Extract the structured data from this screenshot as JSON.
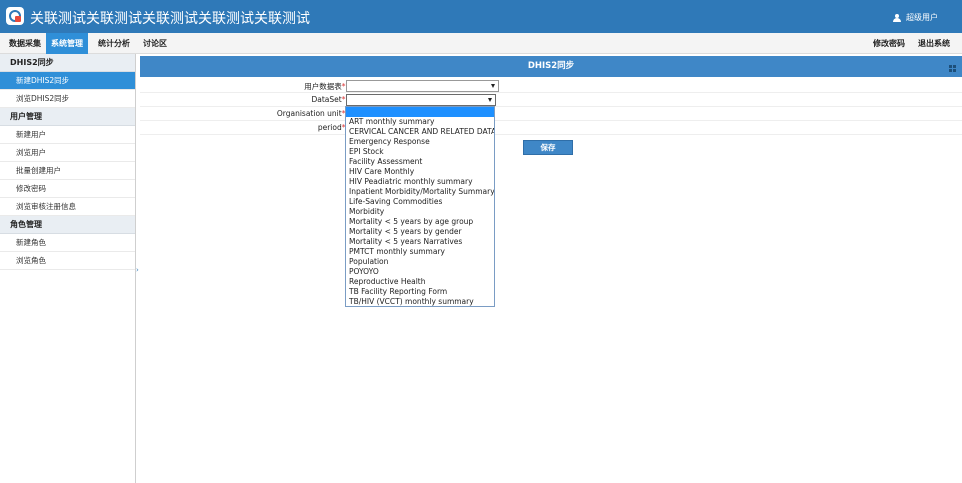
{
  "header": {
    "title": "关联测试关联测试关联测试关联测试关联测试",
    "user": "超级用户"
  },
  "nav": {
    "left": [
      "数据采集",
      "系统管理",
      "统计分析",
      "讨论区"
    ],
    "right": [
      "修改密码",
      "退出系统"
    ]
  },
  "sidebar": {
    "groups": [
      {
        "title": "DHIS2同步",
        "items": [
          "新建DHIS2同步",
          "浏览DHIS2同步"
        ]
      },
      {
        "title": "用户管理",
        "items": [
          "新建用户",
          "浏览用户",
          "批量创建用户",
          "修改密码",
          "浏览审核注册信息"
        ]
      },
      {
        "title": "角色管理",
        "items": [
          "新建角色",
          "浏览角色"
        ]
      }
    ]
  },
  "panel": {
    "title": "DHIS2同步",
    "fields": [
      {
        "label": "用户数据表",
        "required": "*:"
      },
      {
        "label": "DataSet",
        "required": "*:"
      },
      {
        "label": "Organisation unit",
        "required": "*:"
      },
      {
        "label": "period",
        "required": "*:"
      }
    ],
    "save_label": "保存"
  },
  "dropdown": {
    "options": [
      "",
      "ART monthly summary",
      "CERVICAL CANCER AND RELATED DATA",
      "Emergency Response",
      "EPI Stock",
      "Facility Assessment",
      "HIV Care Monthly",
      "HIV Peadiatric monthly summary",
      "Inpatient Morbidity/Mortality Summary",
      "Life-Saving Commodities",
      "Morbidity",
      "Mortality < 5 years by age group",
      "Mortality < 5 years by gender",
      "Mortality < 5 years Narratives",
      "PMTCT monthly summary",
      "Population",
      "POYOYO",
      "Reproductive Health",
      "TB Facility Reporting Form",
      "TB/HIV (VCCT) monthly summary"
    ]
  },
  "colors": {
    "header": "#2f79b8",
    "active": "#2f8fd8",
    "panel_header": "#3f87c7",
    "selected_option": "#1e90ff"
  }
}
